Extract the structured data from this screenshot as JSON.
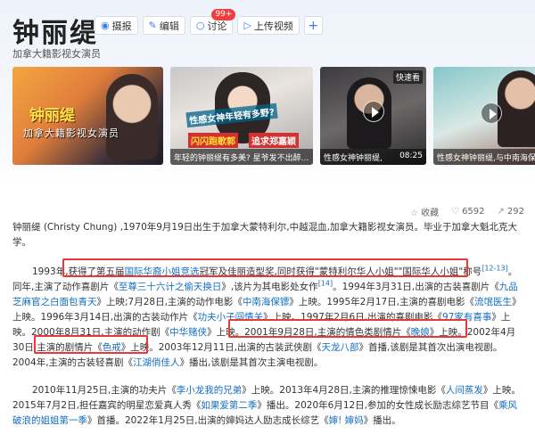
{
  "header": {
    "title": "钟丽缇",
    "subtitle": "加拿大籍影视女演员",
    "actions": [
      {
        "label": "摄报",
        "icon": "camera-icon"
      },
      {
        "label": "编辑",
        "icon": "edit-icon"
      },
      {
        "label": "讨论",
        "icon": "chat-icon",
        "badge": "99+"
      },
      {
        "label": "上传视频",
        "icon": "upload-video-icon"
      },
      {
        "label": "+",
        "icon": "plus-icon"
      }
    ]
  },
  "media": [
    {
      "title_main": "钟丽缇",
      "title_sub": "加拿大籍影视女演员"
    },
    {
      "headline1": "性感女神年轻有多野?",
      "headline2": "闪闪跑歌郭",
      "headline3": "追求郑嘉颖",
      "caption": "年轻的钟丽缇有多美? 星爷发不出醉..."
    },
    {
      "tag": "快速看",
      "caption": "性感女神钟丽缇,",
      "duration": "08:25"
    },
    {
      "caption": "性感女神钟丽缇,与中南海保镖李连..."
    }
  ],
  "stats": {
    "collect_label": "收藏",
    "likes": "6592",
    "shares": "292"
  },
  "paragraphs": {
    "p1": "钟丽缇 (Christy Chung) ,1970年9月19日出生于加拿大蒙特利尔,中越混血,加拿大籍影视女演员。毕业于加拿大魁北克大学。",
    "p2": {
      "a": "1993年,获得了第五届",
      "b": "国际华裔小姐竞选",
      "c": "冠军及佳丽造型奖,同时获得\"蒙特利尔华人小姐\"\"国际华人小姐\"称号",
      "d": "[12-13]",
      "e": "。同年,主演了动作喜剧片《",
      "f": "至尊三十六计之偷天换日",
      "g": "》,该片为其电影处女作",
      "h": "[14]",
      "i": "。1994年3月31日,出演的古装喜剧片《",
      "j": "九品芝麻官之白面包青天",
      "k": "》上映;7月28日,主演的动作电影《",
      "l": "中南海保镖",
      "m": "》上映。1995年2月17日,主演的喜剧电影《",
      "n": "流氓医生",
      "o": "》上映。1996年3月14日,出演的古装动作片《",
      "p": "功夫小子闯情关",
      "q": "》上映。1997年2月6日,出演的喜剧电影《",
      "r": "97家有喜事",
      "s": "》上映。2000年8月31日,主演的动作剧《",
      "t": "中华赌侠",
      "u": "》上映。2001年9月28日,主演的情色类剧情片《",
      "v": "晚娘",
      "w": "》上映。2002年4月30日,主演的剧情片《",
      "x": "色戒",
      "y": "》上映。2003年12月11日,出演的古装武侠剧《",
      "z": "天龙八部",
      "aa": "》首播,该剧是其首次出演电视剧。2004年,主演的古装轻喜剧《",
      "bb": "江湖俏佳人",
      "cc": "》播出,该剧是其首次主演电视剧。"
    },
    "p3": {
      "a": "2010年11月25日,主演的功夫片《",
      "b": "李小龙我的兄弟",
      "c": "》上映。2013年4月28日,主演的推理惊悚电影《",
      "d": "人间蒸发",
      "e": "》上映。2015年7月2日,担任嘉宾的明星恋爱真人秀《",
      "f": "如果爱第二季",
      "g": "》播出。2020年6月12日,参加的女性成长励志综艺节目《",
      "h": "乘风破浪的姐姐第一季",
      "i": "》首播。2022年1月25日,出演的婶妈达人励志成长综艺《",
      "j": "婶! 婶妈",
      "k": "》播出。"
    }
  }
}
